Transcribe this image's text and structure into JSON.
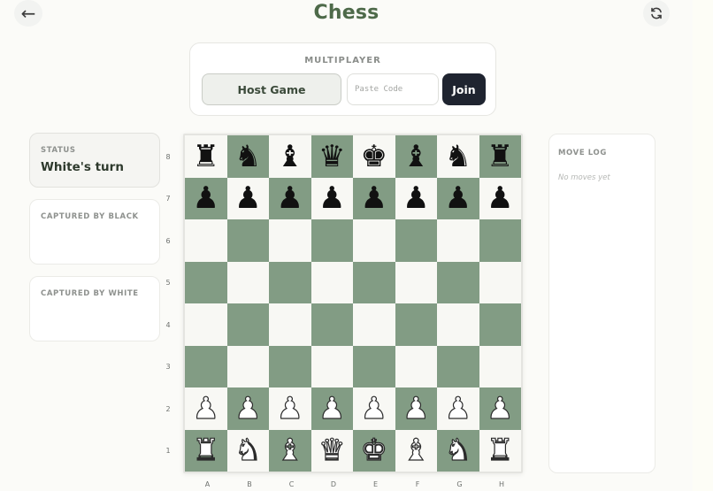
{
  "header": {
    "title": "Chess",
    "back_glyph": "←",
    "refresh_icon": "refresh-icon"
  },
  "multiplayer": {
    "label": "MULTIPLAYER",
    "host_label": "Host Game",
    "code_placeholder": "Paste Code",
    "code_value": "",
    "join_label": "Join"
  },
  "status": {
    "label": "STATUS",
    "value": "White's turn"
  },
  "captured_by_black": {
    "label": "CAPTURED BY BLACK"
  },
  "captured_by_white": {
    "label": "CAPTURED BY WHITE"
  },
  "move_log": {
    "label": "MOVE LOG",
    "empty_text": "No moves yet"
  },
  "board": {
    "files": [
      "A",
      "B",
      "C",
      "D",
      "E",
      "F",
      "G",
      "H"
    ],
    "ranks": [
      "8",
      "7",
      "6",
      "5",
      "4",
      "3",
      "2",
      "1"
    ],
    "colors": {
      "light": "#f8f8f4",
      "dark": "#829c84"
    },
    "position": [
      [
        "br",
        "bn",
        "bb",
        "bq",
        "bk",
        "bb",
        "bn",
        "br"
      ],
      [
        "bp",
        "bp",
        "bp",
        "bp",
        "bp",
        "bp",
        "bp",
        "bp"
      ],
      [
        "",
        "",
        "",
        "",
        "",
        "",
        "",
        ""
      ],
      [
        "",
        "",
        "",
        "",
        "",
        "",
        "",
        ""
      ],
      [
        "",
        "",
        "",
        "",
        "",
        "",
        "",
        ""
      ],
      [
        "",
        "",
        "",
        "",
        "",
        "",
        "",
        ""
      ],
      [
        "wp",
        "wp",
        "wp",
        "wp",
        "wp",
        "wp",
        "wp",
        "wp"
      ],
      [
        "wr",
        "wn",
        "wb",
        "wq",
        "wk",
        "wb",
        "wn",
        "wr"
      ]
    ]
  }
}
